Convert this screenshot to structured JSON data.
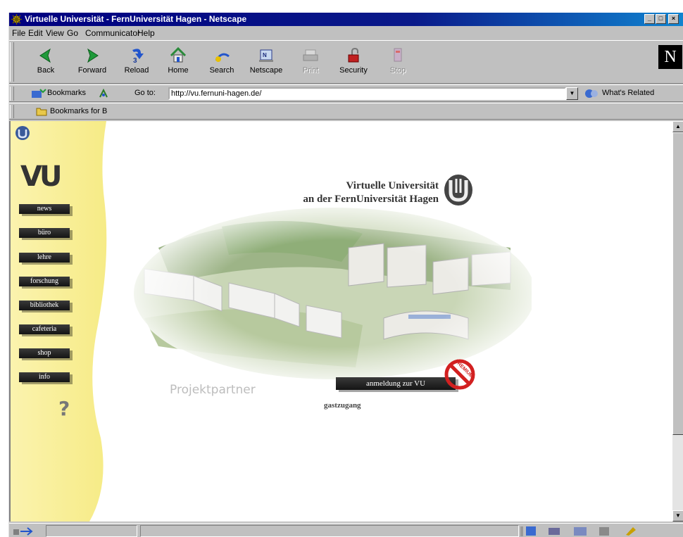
{
  "window": {
    "title": "Virtuelle Universität - FernUniversität Hagen - Netscape",
    "controls": [
      "_",
      "□",
      "×"
    ]
  },
  "menu": [
    "File",
    "Edit",
    "View",
    "Go",
    "Communicator",
    "Help"
  ],
  "navigation_toolbar": [
    {
      "label": "Back",
      "icon": "back-arrow-icon",
      "enabled": true
    },
    {
      "label": "Forward",
      "icon": "forward-arrow-icon",
      "enabled": true
    },
    {
      "label": "Reload",
      "icon": "reload-icon",
      "enabled": true
    },
    {
      "label": "Home",
      "icon": "home-icon",
      "enabled": true
    },
    {
      "label": "Search",
      "icon": "search-icon",
      "enabled": true
    },
    {
      "label": "Netscape",
      "icon": "netscape-icon",
      "enabled": true
    },
    {
      "label": "Print",
      "icon": "print-icon",
      "enabled": false
    },
    {
      "label": "Security",
      "icon": "security-lock-icon",
      "enabled": true
    },
    {
      "label": "Stop",
      "icon": "stop-icon",
      "enabled": false
    }
  ],
  "netscape_logo": "N",
  "location_bar": {
    "bookmarks_label": "Bookmarks",
    "goto_label": "Go to:",
    "url": "http://vu.fernuni-hagen.de/",
    "whats_related": "What's Related"
  },
  "personal_toolbar": {
    "item": "Bookmarks for B"
  },
  "page": {
    "vu_logo": "VU",
    "menu_items": [
      "news",
      "büro",
      "lehre",
      "forschung",
      "bibliothek",
      "cafeteria",
      "shop",
      "info"
    ],
    "help_symbol": "?",
    "title_line1": "Virtuelle Universität",
    "title_line2": "an der FernUniversität Hagen",
    "projektpartner": "Projektpartner",
    "login_button": "anmeldung zur VU",
    "guest_link": "gastzugang",
    "stamp_text": "PREMIUM"
  },
  "colors": {
    "titlebar": "#000080",
    "chrome": "#c0c0c0",
    "sidebar": "#fbf1a6",
    "menu_button": "#1a1a1a"
  }
}
